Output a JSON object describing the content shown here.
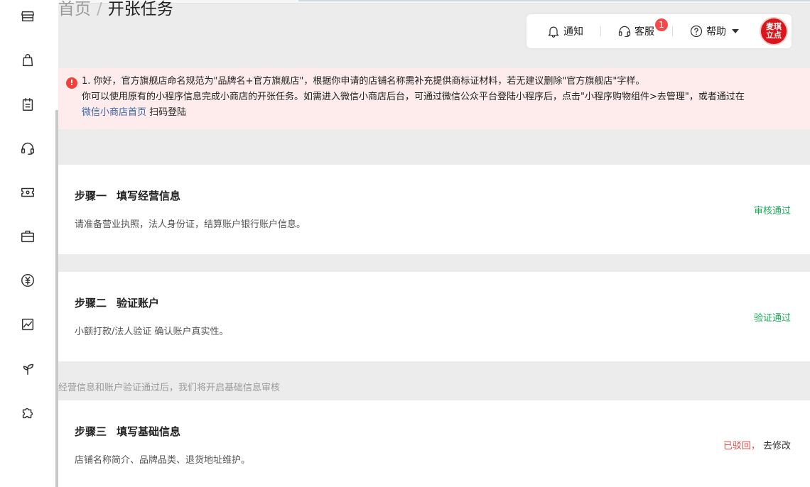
{
  "breadcrumb": {
    "home": "首页",
    "separator": "/",
    "current": "开张任务"
  },
  "sidebar": {
    "icons": [
      "store-icon",
      "bag-icon",
      "clipboard-icon",
      "headset-icon",
      "ticket-icon",
      "briefcase-icon",
      "yen-icon",
      "chart-icon",
      "sprout-icon",
      "puzzle-icon"
    ]
  },
  "toolbar": {
    "notify_label": "通知",
    "service_label": "客服",
    "service_badge": "1",
    "help_label": "帮助",
    "avatar_text_line1": "麦琪",
    "avatar_text_line2": "立点"
  },
  "alert": {
    "line1": "1. 你好，官方旗舰店命名规范为\"品牌名+官方旗舰店\"，根据你申请的店铺名称需补充提供商标证材料，若无建议删除\"官方旗舰店\"字样。",
    "line2": "你可以使用原有的小程序信息完成小商店的开张任务。如需进入微信小商店后台，可通过微信公众平台登陆小程序后，点击\"小程序购物组件>去管理\"，或者通过在",
    "link": "微信小商店首页",
    "line3_tail": "扫码登陆"
  },
  "steps": [
    {
      "step": "步骤一",
      "title": "填写经营信息",
      "desc": "请准备营业执照，法人身份证，结算账户银行账户信息。",
      "status": "审核通过"
    },
    {
      "step": "步骤二",
      "title": "验证账户",
      "desc": "小额打款/法人验证 确认账户真实性。",
      "status": "验证通过"
    },
    {
      "step": "步骤三",
      "title": "填写基础信息",
      "desc": "店铺名称简介、品牌品类、退货地址维护。",
      "status": "已驳回，",
      "action": "去修改"
    }
  ],
  "hint": "经营信息和账户验证通过后，我们将开启基础信息审核",
  "colors": {
    "success": "#1aab57",
    "rejected": "#e24d4d",
    "alert_bg": "#fdeceb",
    "link": "#3b64a8"
  }
}
